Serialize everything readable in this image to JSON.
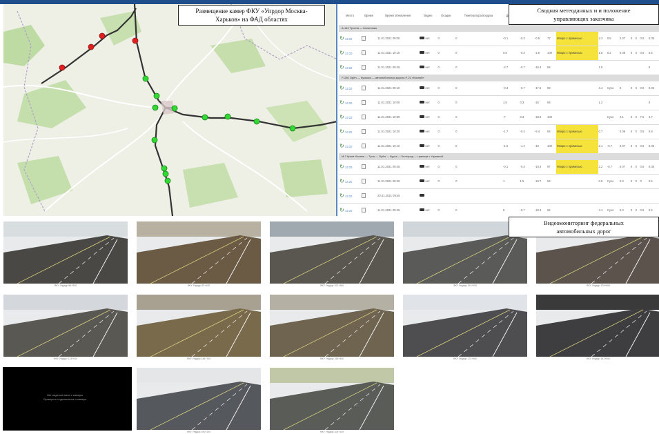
{
  "map": {
    "title_line1": "Размещение камер ФКУ «Упрдор Москва-",
    "title_line2": "Харьков» на ФАД областях",
    "red_color": "#e02020",
    "green_color": "#33d933"
  },
  "panel": {
    "title_line1": "Сводная метеоданных и и положение",
    "title_line2": "управляющих заказчика",
    "headers": [
      "Место",
      "Время",
      "Время обновления",
      "Видео",
      "Осадки",
      "Температура воздуха",
      "Дорога",
      "Ветер",
      "",
      "",
      "",
      "",
      "",
      ""
    ],
    "sections": [
      {
        "label": "А-142 Тросна — Калиновка",
        "rows": [
          {
            "time": "13:20",
            "date": "11.01.2021 09:00",
            "status": "нет",
            "hl": "Мокро с примесью",
            "v": [
              "0",
              "0",
              "-0.1",
              "-0.3",
              "-0.5",
              "77",
              "2.3",
              "0.5",
              "2.07",
              "0",
              "0",
              "0.5",
              "0.05"
            ]
          },
          {
            "time": "13:20",
            "date": "11.01.2021 10:10",
            "status": "нет",
            "hl": "Мокро с примесью",
            "v": [
              "0",
              "0",
              "0.5",
              "-0.3",
              "-1.6",
              "100",
              "1.8",
              "0.2",
              "0.08",
              "0",
              "0",
              "0.5",
              "0.5"
            ]
          },
          {
            "time": "13:20",
            "date": "11.01.2021 09:45",
            "status": "нет",
            "hl": "",
            "v": [
              "0",
              "0",
              "-2.7",
              "-0.7",
              "-16.4",
              "94",
              "1.8",
              "",
              "",
              "",
              "",
              "",
              "0"
            ]
          }
        ]
      },
      {
        "label": "Р-280 Орёл — Курская — автомобильная дорога Р-22 «Каспий»",
        "rows": [
          {
            "time": "13:20",
            "date": "11.01.2021 09:10",
            "status": "нет",
            "hl": "",
            "v": [
              "0",
              "0",
              "-0.3",
              "-0.7",
              "-17.5",
              "98",
              "3.4",
              "Сухо",
              "0",
              "0",
              "0",
              "0.5",
              "0.03"
            ]
          },
          {
            "time": "13:20",
            "date": "11.01.2021 10:00",
            "status": "нет",
            "hl": "",
            "v": [
              "0",
              "0",
              "1.5",
              "0.3",
              "-18",
              "94",
              "1.2",
              "",
              "",
              "",
              "",
              "",
              "0"
            ]
          },
          {
            "time": "13:20",
            "date": "11.01.2021 10:00",
            "status": "нет",
            "hl": "",
            "v": [
              "0",
              "0",
              "-7",
              "0.3",
              "-18.5",
              "100",
              "",
              "Сухо",
              "4.1",
              "0",
              "0",
              "7.6",
              "4.7"
            ]
          },
          {
            "time": "13:20",
            "date": "11.01.2021 10:20",
            "status": "нет",
            "hl": "Мокро с примесью",
            "v": [
              "0",
              "0",
              "-1.7",
              "-0.4",
              "-9.4",
              "94",
              "0.7",
              "",
              "0.09",
              "0",
              "0",
              "0.5",
              "0.8"
            ]
          },
          {
            "time": "13:20",
            "date": "11.01.2021 10:10",
            "status": "нет",
            "hl": "Мокро с примесью",
            "v": [
              "0",
              "0",
              "-1.0",
              "-1.4",
              "-19",
              "100",
              "2.1",
              "-0.7",
              "0.07",
              "0",
              "0",
              "0.5",
              "0.05"
            ]
          }
        ]
      },
      {
        "label": "М-2 Крым Москва — Тула — Орёл — Курск — Белгород — граница с Украиной",
        "rows": [
          {
            "time": "13:20",
            "date": "11.01.2021 09:45",
            "status": "нет",
            "hl": "Мокро с примесью",
            "v": [
              "0",
              "0",
              "-0.1",
              "-0.3",
              "-10.3",
              "97",
              "2.2",
              "-0.7",
              "0.07",
              "0",
              "0",
              "0.5",
              "0.05"
            ]
          },
          {
            "time": "13:20",
            "date": "11.01.2021 09:45",
            "status": "нет",
            "hl": "",
            "v": [
              "0",
              "0",
              "1",
              "1.5",
              "-18.7",
              "94",
              "0.8",
              "Сухо",
              "0.3",
              "0",
              "0",
              "0",
              "0.5"
            ]
          },
          {
            "time": "13:20",
            "date": "20.01.2021 09:45",
            "status": "",
            "hl": "",
            "v": [
              "",
              "",
              "",
              "",
              "",
              "",
              "",
              "",
              "",
              "",
              "",
              "",
              ""
            ]
          },
          {
            "time": "13:20",
            "date": "11.01.2021 09:45",
            "status": "нет",
            "hl": "",
            "v": [
              "0",
              "0",
              "6",
              "-0.7",
              "-18.3",
              "94",
              "4.1",
              "Сухо",
              "0.3",
              "0",
              "0",
              "0.5",
              "0.5"
            ]
          },
          {
            "time": "13:20",
            "date": "11.01.2021 10:00",
            "status": "нет",
            "hl": "",
            "v": [
              "0",
              "0",
              "0.4",
              "0",
              "-18.6",
              "94",
              "2.1",
              "",
              "",
              "",
              "",
              "",
              "0"
            ]
          }
        ]
      }
    ]
  },
  "cams": {
    "title_line1": "Видеомониторинг федеральных",
    "title_line2": "автомобильных дорог",
    "no_signal_line1": "Нет видеосигнала с камеры",
    "no_signal_line2": "Проверьте подключение к камере",
    "captions": [
      "ФКУ Упрдор 86+500",
      "ФКУ Упрдор 92+100",
      "ФКУ Упрдор 101+300",
      "ФКУ Упрдор 114+200",
      "ФКУ Упрдор 125+800",
      "ФКУ Упрдор 133+000",
      "ФКУ Упрдор 146+700",
      "ФКУ Упрдор 158+400",
      "ФКУ Упрдор 172+900",
      "ФКУ Упрдор 181+600",
      "ФКУ Упрдор 190+200",
      "ФКУ Упрдор 204+100"
    ]
  }
}
